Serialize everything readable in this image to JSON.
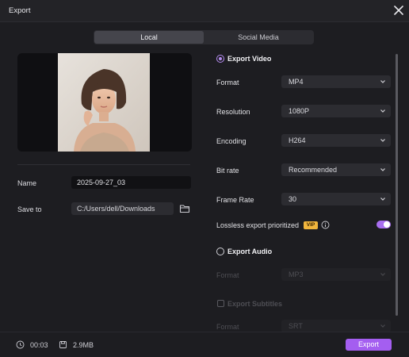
{
  "window": {
    "title": "Export"
  },
  "tabs": [
    {
      "label": "Local"
    },
    {
      "label": "Social Media"
    }
  ],
  "left": {
    "name_label": "Name",
    "name_value": "2025-09-27_03",
    "saveto_label": "Save to",
    "saveto_value": "C:/Users/dell/Downloads"
  },
  "video": {
    "section_label": "Export Video",
    "rows": [
      {
        "label": "Format",
        "value": "MP4"
      },
      {
        "label": "Resolution",
        "value": "1080P"
      },
      {
        "label": "Encoding",
        "value": "H264"
      },
      {
        "label": "Bit rate",
        "value": "Recommended"
      },
      {
        "label": "Frame Rate",
        "value": "30"
      }
    ],
    "lossless_label": "Lossless export prioritized",
    "vip_badge": "VIP"
  },
  "audio": {
    "section_label": "Export Audio",
    "format_label": "Format",
    "format_value": "MP3"
  },
  "subtitles": {
    "section_label": "Export Subtitles",
    "format_label": "Format",
    "format_value": "SRT"
  },
  "footer": {
    "duration": "00:03",
    "size": "2.9MB",
    "export_label": "Export"
  },
  "colors": {
    "accent": "#a45ef0",
    "vip": "#f0b53d",
    "background": "#1d1d21"
  },
  "icons": [
    "close-icon",
    "folder-icon",
    "clock-icon",
    "file-size-icon",
    "info-icon",
    "chevron-down-icon"
  ]
}
